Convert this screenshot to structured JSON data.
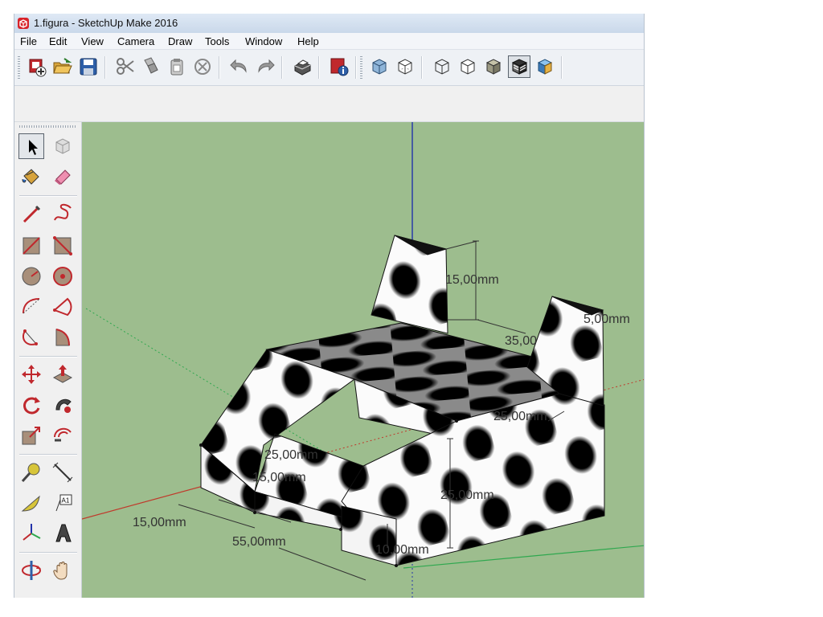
{
  "window": {
    "title": "1.figura - SketchUp Make 2016"
  },
  "menu": [
    "File",
    "Edit",
    "View",
    "Camera",
    "Draw",
    "Tools",
    "Window",
    "Help"
  ],
  "toolbar": {
    "buttons": [
      "new-icon",
      "open-icon",
      "save-icon",
      "cut-icon",
      "copy-icon",
      "paste-icon",
      "erase-icon",
      "undo-icon",
      "redo-icon",
      "print-icon",
      "model-info-icon",
      "xray-icon",
      "back-edges-icon",
      "wireframe-icon",
      "hidden-line-icon",
      "shaded-icon",
      "shaded-textures-icon",
      "monochrome-icon"
    ],
    "active_style": "shaded-textures-icon"
  },
  "palette": {
    "tools": [
      "select-icon",
      "make-component-icon",
      "paint-bucket-icon",
      "eraser-icon",
      "line-icon",
      "freehand-icon",
      "rectangle-icon",
      "rotated-rectangle-icon",
      "circle-icon",
      "polygon-icon",
      "arc-icon",
      "pie-icon",
      "three-point-arc-icon",
      "two-point-arc-icon",
      "move-icon",
      "push-pull-icon",
      "rotate-icon",
      "follow-me-icon",
      "scale-icon",
      "offset-icon",
      "tape-measure-icon",
      "dimension-icon",
      "protractor-icon",
      "text-icon",
      "axes-icon",
      "3d-text-icon",
      "orbit-icon",
      "pan-icon"
    ],
    "active": "select-icon",
    "text_tool_label": "A1"
  },
  "dimensions": {
    "left_height": "15,00mm",
    "back_width": "35,00",
    "right_post_width": "5,00mm",
    "right_top_depth": "25,00mm",
    "notch_depth": "25,00mm",
    "notch_height": "15,00mm",
    "front_height": "25,00mm",
    "left_depth": "15,00mm",
    "total_width": "55,00mm",
    "step_height": "10,00mm"
  },
  "colors": {
    "ground": "#9dbd8e",
    "title_bar": "#d6e3f2",
    "axis_red": "#c0392b",
    "axis_green": "#2fa84f",
    "axis_blue": "#2233aa"
  }
}
